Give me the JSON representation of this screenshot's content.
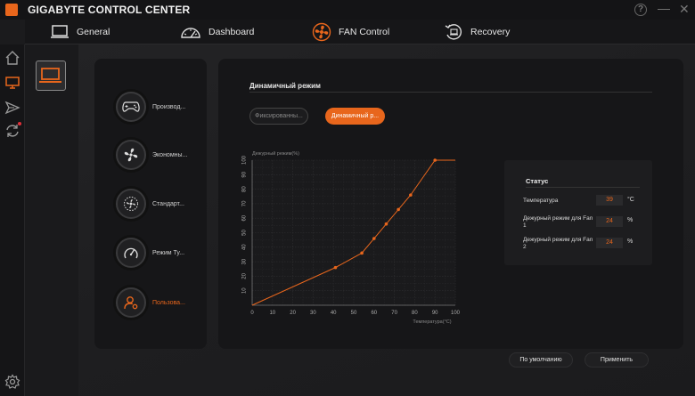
{
  "app": {
    "title": "GIGABYTE CONTROL CENTER",
    "help_label": "?",
    "minimize_label": "—",
    "close_label": "✕"
  },
  "nav": {
    "items": [
      {
        "label": "General",
        "icon": "laptop-icon"
      },
      {
        "label": "Dashboard",
        "icon": "gauge-icon"
      },
      {
        "label": "FAN Control",
        "icon": "fan-icon"
      },
      {
        "label": "Recovery",
        "icon": "recovery-icon"
      }
    ],
    "active": "FAN Control"
  },
  "sidebar": {
    "items": [
      {
        "icon": "home-icon"
      },
      {
        "icon": "monitor-icon",
        "active": true
      },
      {
        "icon": "send-icon"
      },
      {
        "icon": "sync-icon",
        "badge": true
      }
    ],
    "bottom_icon": "settings-icon"
  },
  "modes": {
    "items": [
      {
        "label": "Производ...",
        "icon": "gamepad-icon"
      },
      {
        "label": "Экономны...",
        "icon": "leaf-fan-icon"
      },
      {
        "label": "Стандарт...",
        "icon": "fan-dots-icon"
      },
      {
        "label": "Режим Ту...",
        "icon": "turbo-gauge-icon"
      },
      {
        "label": "Пользова...",
        "icon": "user-settings-icon",
        "active": true
      }
    ]
  },
  "main": {
    "title": "Динамичный режим",
    "fixed_label": "Фиксированны...",
    "dynamic_label": "Динамичный р..."
  },
  "chart_data": {
    "type": "line",
    "title": "",
    "ylabel": "Дежурный режим(%)",
    "xlabel": "Температура(°C)",
    "x": [
      0,
      41,
      54,
      60,
      66,
      72,
      78,
      90
    ],
    "series": [
      {
        "values": [
          0,
          26,
          36,
          46,
          56,
          66,
          76,
          100
        ]
      }
    ],
    "xlim": [
      0,
      100
    ],
    "ylim": [
      0,
      100
    ],
    "xticks": [
      0,
      10,
      20,
      30,
      40,
      50,
      60,
      70,
      80,
      90,
      100
    ],
    "yticks": [
      10,
      20,
      30,
      40,
      50,
      60,
      70,
      80,
      90,
      100
    ],
    "grid": true,
    "line_color": "#e8661c"
  },
  "status": {
    "title": "Статус",
    "rows": [
      {
        "label": "Температура",
        "value": "39",
        "unit": "°C"
      },
      {
        "label": "Дежурный режим для Fan 1",
        "value": "24",
        "unit": "%"
      },
      {
        "label": "Дежурный режим для Fan 2",
        "value": "24",
        "unit": "%"
      }
    ]
  },
  "buttons": {
    "default_label": "По умолчанию",
    "apply_label": "Применить"
  },
  "colors": {
    "accent": "#e8661c",
    "background": "#1b1b1d",
    "panel": "#161618"
  }
}
